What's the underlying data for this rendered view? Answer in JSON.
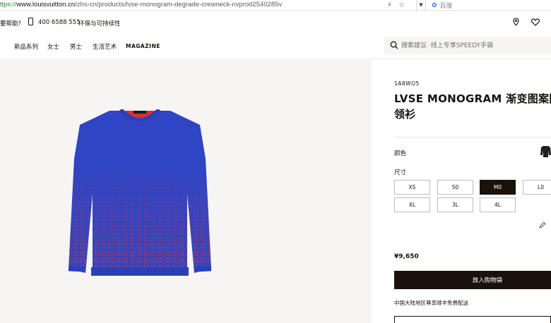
{
  "browser": {
    "url_protocol": "ttps://",
    "url_domain": "www.louisvuitton.cn",
    "url_path": "/zhs-cn/products/lvse-monogram-degrade-crewneck-nvprod2540285v",
    "search_placeholder": "百度",
    "icons": [
      "lightning-icon",
      "star-icon",
      "chevron-down-icon",
      "paw-icon"
    ]
  },
  "utility": {
    "help": "要帮助?",
    "phone": "400 6588 555",
    "sustainability": "环保与可持续性",
    "icons": [
      "phone-icon",
      "location-pin-icon",
      "heart-icon"
    ]
  },
  "nav": {
    "items": [
      "新品系列",
      "女士",
      "男士",
      "生活艺术",
      "MAGAZINE"
    ],
    "search_placeholder": "搜索建议  线上专享SPEEDY手袋"
  },
  "product": {
    "sku": "1A8WO5",
    "title": "LVSE MONOGRAM 渐变图案圆领衫",
    "color_label": "颜色",
    "size_label": "尺寸",
    "sizes": [
      "XS",
      "S0",
      "M0",
      "L0",
      "XL",
      "3L",
      "4L"
    ],
    "selected_size": "M0",
    "price": "¥9,650",
    "add_to_cart": "放入购物袋",
    "shipping_note": "中国大陆地区尊享顺丰免费配送",
    "colors": {
      "sweater_blue": "#2f45c4",
      "pattern_red": "#d2303b",
      "dark": "#19110b"
    }
  }
}
